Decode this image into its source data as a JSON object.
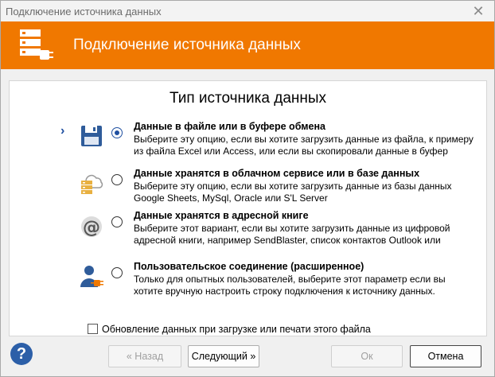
{
  "window": {
    "title": "Подключение источника данных",
    "close_glyph": "✕"
  },
  "header": {
    "title": "Подключение источника данных",
    "logo_icon": "database-plug-icon"
  },
  "panel": {
    "title": "Тип источника данных"
  },
  "options": [
    {
      "title": "Данные в файле или в буфере обмена",
      "description": "Выберите эту опцию, если вы хотите загрузить данные из файла, к примеру из файла Excel или Access, или если вы скопировали данные в буфер обмена",
      "icon": "floppy-disk-icon",
      "selected": true
    },
    {
      "title": "Данные хранятся в облачном сервисе или в базе данных",
      "description": "Выберите эту опцию, если вы хотите загрузить данные из базы данных Google Sheets, MySql, Oracle или S'L Server",
      "icon": "cloud-database-icon",
      "selected": false
    },
    {
      "title": "Данные хранятся в адресной книге",
      "description": "Выберите этот вариант, если вы хотите загрузить данные из цифровой адресной книги, например SendBlaster, список контактов Outlook или адресной книги Windows",
      "icon": "at-sign-icon",
      "selected": false
    },
    {
      "title": "Пользовательское соединение (расширенное)",
      "description": "Только для опытных пользователей, выберите этот параметр если вы хотите вручную настроить строку подключения к источнику данных.",
      "icon": "user-plug-icon",
      "selected": false
    }
  ],
  "checkbox": {
    "label": "Обновление данных при загрузке или печати этого файла",
    "checked": false
  },
  "footer": {
    "help_glyph": "?",
    "back_label": "« Назад",
    "next_label": "Следующий »",
    "ok_label": "Ок",
    "cancel_label": "Отмена"
  },
  "colors": {
    "header": "#f07800",
    "accent": "#1f4fa0"
  }
}
